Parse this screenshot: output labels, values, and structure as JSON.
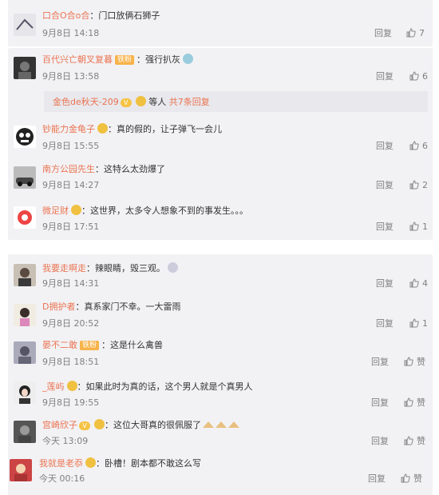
{
  "comments": [
    {
      "name": "口合O合o合",
      "tags": [],
      "vip": false,
      "text": "：门口放俩石狮子",
      "time": "9月8日 14:18",
      "reply": "回复",
      "likes": "7"
    },
    {
      "name": "百代兴亡朝叉复暮",
      "tags": [
        "铁粉"
      ],
      "vip": false,
      "text": "：强行扒灰",
      "time": "9月8日 13:58",
      "reply": "回复",
      "likes": "6",
      "sub": {
        "user": "金色de秋天-209",
        "middle": "等人",
        "link": "共7条回复"
      }
    },
    {
      "name": "钞能力金龟子",
      "tags": [],
      "vip": true,
      "text": "：真的假的，让子弹飞一会儿",
      "time": "9月8日 15:55",
      "reply": "回复",
      "likes": "6"
    },
    {
      "name": "南方公园先生",
      "tags": [],
      "vip": false,
      "text": "：这特么太劲爆了",
      "time": "9月8日 14:27",
      "reply": "回复",
      "likes": "2"
    },
    {
      "name": "微足财",
      "tags": [],
      "vip": true,
      "text": "：这世界，太多令人想象不到的事发生。。。",
      "time": "9月8日 17:51",
      "reply": "回复",
      "likes": "1"
    },
    {
      "name": "我要走啊走",
      "tags": [],
      "vip": false,
      "text": "：辣眼睛，毁三观。",
      "time": "9月8日 14:31",
      "reply": "回复",
      "likes": "4"
    },
    {
      "name": "D拥护者",
      "tags": [],
      "vip": false,
      "text": "：真系家门不幸。一大雷雨",
      "time": "9月8日 20:52",
      "reply": "回复",
      "likes": "1"
    },
    {
      "name": "晏不二敢",
      "tags": [
        "铁粉"
      ],
      "vip": false,
      "text": "：这是什么禽兽",
      "time": "9月8日 18:51",
      "reply": "回复",
      "likes": "赞"
    },
    {
      "name": "_莲屿",
      "tags": [],
      "vip": true,
      "text": "：如果此时为真的话，这个男人就是个真男人",
      "time": "9月8日 19:55",
      "reply": "回复",
      "likes": "赞"
    },
    {
      "name": "宫崎欣子",
      "tags": [],
      "vip": true,
      "text": "：这位大哥真的很佩服了",
      "time": "今天 13:09",
      "reply": "回复",
      "likes": "赞"
    },
    {
      "name": "我就是老忝",
      "tags": [],
      "vip": true,
      "text": "：卧槽！剧本都不敢这么写",
      "time": "今天 00:16",
      "reply": "回复",
      "likes": "赞"
    }
  ],
  "colors": {
    "name": "#eb7350",
    "link": "#eb7350",
    "meta": "#808080",
    "bg": "#f2f2f5"
  }
}
